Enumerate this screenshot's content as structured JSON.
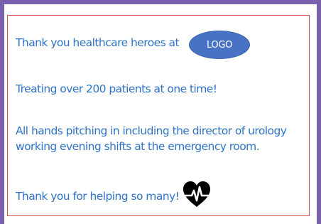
{
  "card": {
    "line1": "Thank you healthcare heroes at",
    "logo_label": "LOGO",
    "line2": "Treating over 200 patients at one time!",
    "line3a": "All hands pitching in including the director of urology",
    "line3b": "working evening shifts at the emergency room.",
    "line4": "Thank you for helping so many!",
    "heart_icon": "heartbeat-heart-icon"
  },
  "colors": {
    "frame": "#7b60ad",
    "text": "#2f73c7",
    "border": "#d84b4b",
    "logo": "#4873c4"
  }
}
